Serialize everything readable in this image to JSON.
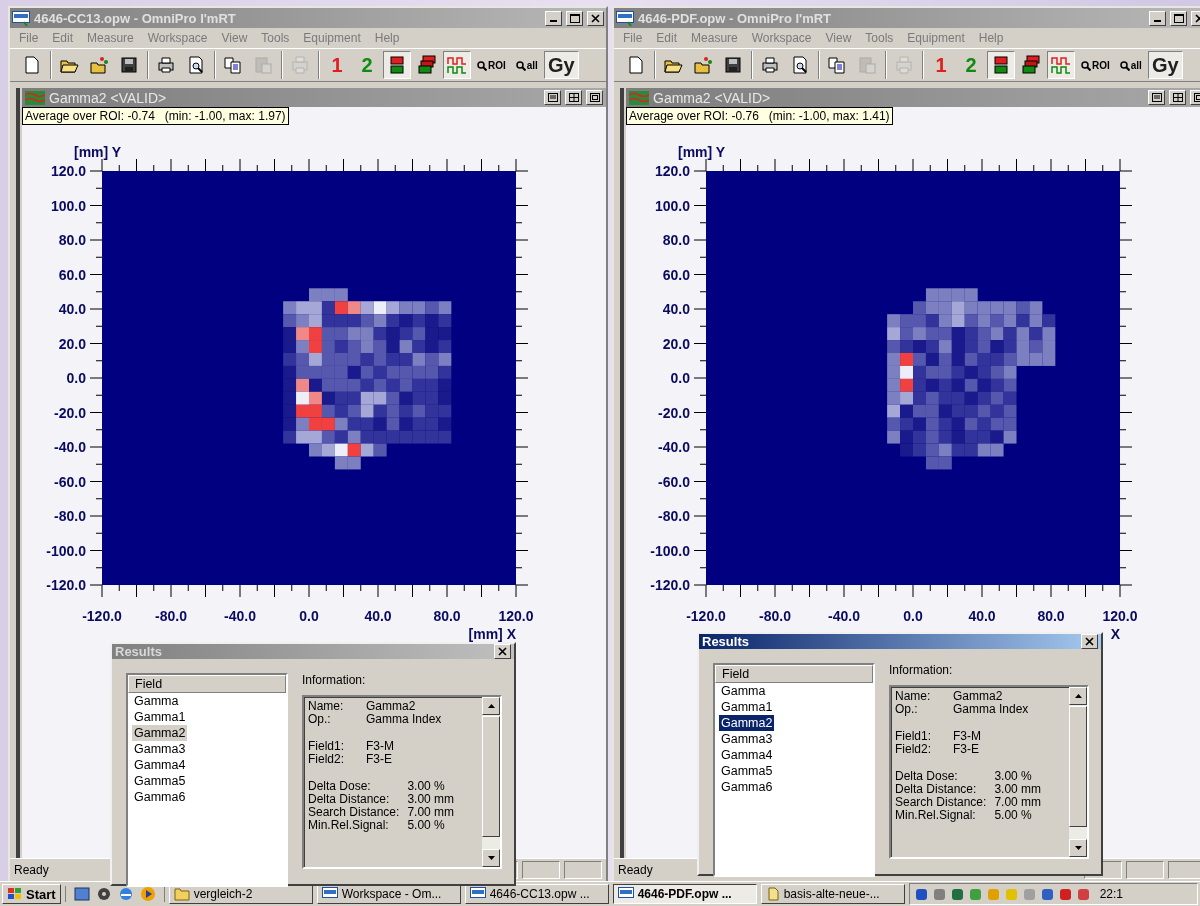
{
  "windows": [
    {
      "title": "4646-CC13.opw - OmniPro I'mRT",
      "menu": [
        "File",
        "Edit",
        "Measure",
        "Workspace",
        "View",
        "Tools",
        "Equipment",
        "Help"
      ],
      "toolbar": [
        [
          {
            "kind": "icon",
            "pressed": false,
            "disabled": false
          }
        ],
        [
          {
            "kind": "icon",
            "pressed": false,
            "disabled": false
          },
          {
            "kind": "icon",
            "pressed": false,
            "disabled": false
          },
          {
            "kind": "icon",
            "pressed": false,
            "disabled": false
          }
        ],
        [
          {
            "kind": "icon",
            "pressed": false,
            "disabled": false
          },
          {
            "kind": "icon",
            "pressed": false,
            "disabled": false
          }
        ],
        [
          {
            "kind": "icon",
            "pressed": false,
            "disabled": false
          },
          {
            "kind": "icon",
            "pressed": false,
            "disabled": true
          }
        ],
        [
          {
            "kind": "icon",
            "pressed": false,
            "disabled": true
          }
        ],
        [
          {
            "kind": "text",
            "label": "1",
            "color": "#e02020",
            "pressed": false,
            "disabled": false
          },
          {
            "kind": "text",
            "label": "2",
            "color": "#108a10",
            "pressed": false,
            "disabled": false
          },
          {
            "kind": "icon",
            "pressed": true,
            "disabled": false
          },
          {
            "kind": "icon",
            "pressed": false,
            "disabled": false
          },
          {
            "kind": "icon",
            "pressed": true,
            "disabled": false
          },
          {
            "kind": "badge",
            "label": "ROI",
            "pressed": false,
            "disabled": false
          },
          {
            "kind": "badge",
            "label": "all",
            "pressed": false,
            "disabled": false
          },
          {
            "kind": "text",
            "label": "Gy",
            "color": "#202020",
            "pressed": true,
            "disabled": false
          }
        ]
      ],
      "document": {
        "title": "Gamma2 <VALID>",
        "tooltip": "Average over ROI: -0.74   (min: -1.00, max: 1.97)",
        "y_label": "[mm] Y",
        "x_label": "[mm] X",
        "yticks": [
          "120.0",
          "100.0",
          "80.0",
          "60.0",
          "40.0",
          "20.0",
          "0.0",
          "-20.0",
          "-40.0",
          "-60.0",
          "-80.0",
          "-100.0",
          "-120.0"
        ],
        "xticks": [
          "-120.0",
          "-80.0",
          "-40.0",
          "0.0",
          "40.0",
          "80.0",
          "120.0"
        ]
      },
      "status": "Ready",
      "dialog": {
        "title": "Results",
        "active": false,
        "list_header": "Field",
        "items": [
          {
            "label": "Gamma",
            "selected": false
          },
          {
            "label": "Gamma1",
            "selected": false
          },
          {
            "label": "Gamma2",
            "selected": true
          },
          {
            "label": "Gamma3",
            "selected": false
          },
          {
            "label": "Gamma4",
            "selected": false
          },
          {
            "label": "Gamma5",
            "selected": false
          },
          {
            "label": "Gamma6",
            "selected": false
          }
        ],
        "info_label": "Information:",
        "info": [
          [
            {
              "label": "Name:",
              "value": "Gamma2"
            },
            {
              "label": "Op.:",
              "value": "Gamma Index"
            }
          ],
          [
            {
              "label": "Field1:",
              "value": "F3-M"
            },
            {
              "label": "Field2:",
              "value": "F3-E"
            }
          ],
          [
            {
              "label": "Delta Dose:",
              "value": "3.00 %"
            },
            {
              "label": "Delta Distance:",
              "value": "3.00 mm"
            },
            {
              "label": "Search Distance:",
              "value": "7.00 mm"
            },
            {
              "label": "Min.Rel.Signal:",
              "value": "5.00 %"
            }
          ]
        ]
      }
    },
    {
      "title": "4646-PDF.opw - OmniPro I'mRT",
      "menu": [
        "File",
        "Edit",
        "Measure",
        "Workspace",
        "View",
        "Tools",
        "Equipment",
        "Help"
      ],
      "toolbar": [
        [
          {
            "kind": "icon",
            "pressed": false,
            "disabled": false
          }
        ],
        [
          {
            "kind": "icon",
            "pressed": false,
            "disabled": false
          },
          {
            "kind": "icon",
            "pressed": false,
            "disabled": false
          },
          {
            "kind": "icon",
            "pressed": false,
            "disabled": false
          }
        ],
        [
          {
            "kind": "icon",
            "pressed": false,
            "disabled": false
          },
          {
            "kind": "icon",
            "pressed": false,
            "disabled": false
          }
        ],
        [
          {
            "kind": "icon",
            "pressed": false,
            "disabled": false
          },
          {
            "kind": "icon",
            "pressed": false,
            "disabled": true
          }
        ],
        [
          {
            "kind": "icon",
            "pressed": false,
            "disabled": true
          }
        ],
        [
          {
            "kind": "text",
            "label": "1",
            "color": "#e02020",
            "pressed": false,
            "disabled": false
          },
          {
            "kind": "text",
            "label": "2",
            "color": "#108a10",
            "pressed": false,
            "disabled": false
          },
          {
            "kind": "icon",
            "pressed": true,
            "disabled": false
          },
          {
            "kind": "icon",
            "pressed": false,
            "disabled": false
          },
          {
            "kind": "icon",
            "pressed": true,
            "disabled": false
          },
          {
            "kind": "badge",
            "label": "ROI",
            "pressed": false,
            "disabled": false
          },
          {
            "kind": "badge",
            "label": "all",
            "pressed": false,
            "disabled": false
          },
          {
            "kind": "text",
            "label": "Gy",
            "color": "#202020",
            "pressed": true,
            "disabled": false
          }
        ]
      ],
      "document": {
        "title": "Gamma2 <VALID>",
        "tooltip": "Average over ROI: -0.76   (min: -1.00, max: 1.41)",
        "y_label": "[mm] Y",
        "x_label": "X",
        "yticks": [
          "120.0",
          "100.0",
          "80.0",
          "60.0",
          "40.0",
          "20.0",
          "0.0",
          "-20.0",
          "-40.0",
          "-60.0",
          "-80.0",
          "-100.0",
          "-120.0"
        ],
        "xticks": [
          "-120.0",
          "-80.0",
          "-40.0",
          "0.0",
          "40.0",
          "80.0",
          "120.0"
        ]
      },
      "status": "Ready",
      "dialog": {
        "title": "Results",
        "active": true,
        "list_header": "Field",
        "items": [
          {
            "label": "Gamma",
            "selected": false
          },
          {
            "label": "Gamma1",
            "selected": false
          },
          {
            "label": "Gamma2",
            "selected": true
          },
          {
            "label": "Gamma3",
            "selected": false
          },
          {
            "label": "Gamma4",
            "selected": false
          },
          {
            "label": "Gamma5",
            "selected": false
          },
          {
            "label": "Gamma6",
            "selected": false
          }
        ],
        "info_label": "Information:",
        "info": [
          [
            {
              "label": "Name:",
              "value": "Gamma2"
            },
            {
              "label": "Op.:",
              "value": "Gamma Index"
            }
          ],
          [
            {
              "label": "Field1:",
              "value": "F3-M"
            },
            {
              "label": "Field2:",
              "value": "F3-E"
            }
          ],
          [
            {
              "label": "Delta Dose:",
              "value": "3.00 %"
            },
            {
              "label": "Delta Distance:",
              "value": "3.00 mm"
            },
            {
              "label": "Search Distance:",
              "value": "7.00 mm"
            },
            {
              "label": "Min.Rel.Signal:",
              "value": "5.00 %"
            }
          ]
        ]
      }
    }
  ],
  "taskbar": {
    "start": "Start",
    "tasks": [
      {
        "label": "vergleich-2",
        "kind": "folder",
        "selected": false
      },
      {
        "label": "Workspace - Om...",
        "kind": "app",
        "selected": false
      },
      {
        "label": "4646-CC13.opw ...",
        "kind": "app",
        "selected": false
      },
      {
        "label": "4646-PDF.opw ...",
        "kind": "app",
        "selected": true
      },
      {
        "label": "basis-alte-neue-...",
        "kind": "file",
        "selected": false
      }
    ],
    "clock": "22:1"
  }
}
